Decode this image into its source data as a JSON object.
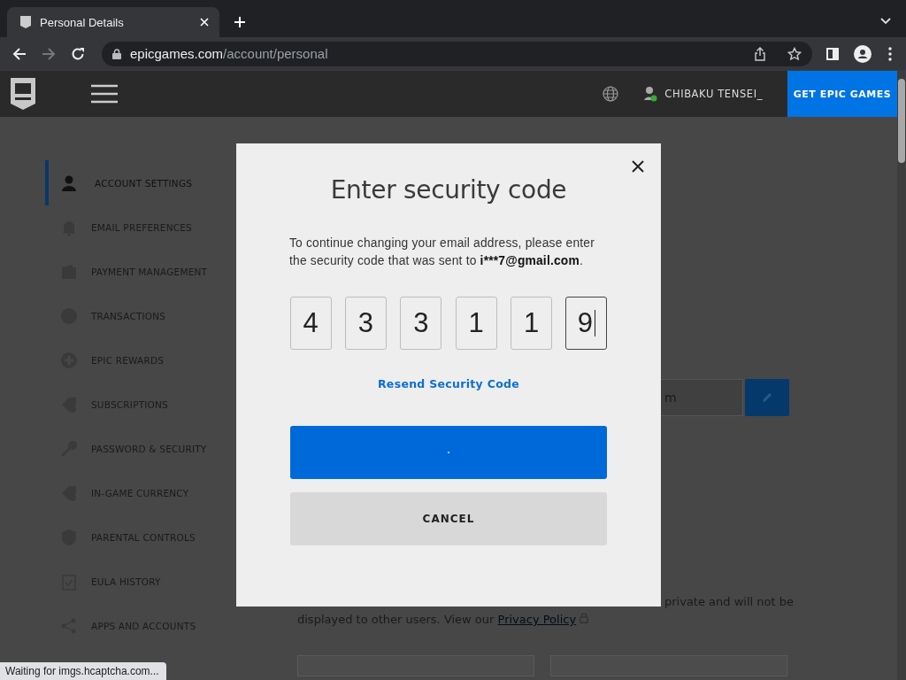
{
  "browser": {
    "tab": {
      "title": "Personal Details"
    },
    "url": {
      "host": "epicgames.com",
      "path": "/account/personal"
    }
  },
  "site_header": {
    "username": "CHIBAKU TENSEI_",
    "cta": "GET EPIC GAMES"
  },
  "sidebar": {
    "items": [
      {
        "label": "ACCOUNT SETTINGS",
        "selected": true
      },
      {
        "label": "EMAIL PREFERENCES",
        "selected": false
      },
      {
        "label": "PAYMENT MANAGEMENT",
        "selected": false
      },
      {
        "label": "TRANSACTIONS",
        "selected": false
      },
      {
        "label": "EPIC REWARDS",
        "selected": false
      },
      {
        "label": "SUBSCRIPTIONS",
        "selected": false
      },
      {
        "label": "PASSWORD & SECURITY",
        "selected": false
      },
      {
        "label": "IN-GAME CURRENCY",
        "selected": false
      },
      {
        "label": "PARENTAL CONTROLS",
        "selected": false
      },
      {
        "label": "EULA HISTORY",
        "selected": false
      },
      {
        "label": "APPS AND ACCOUNTS",
        "selected": false
      }
    ]
  },
  "content": {
    "email_field": {
      "value": "m"
    },
    "privacy": {
      "line_1": "private and will not be",
      "line_2": "displayed to other users. View our ",
      "link": "Privacy Policy"
    }
  },
  "modal": {
    "title": "Enter security code",
    "message": {
      "text": "To continue changing your email address, please enter the security code that was sent to ",
      "email": "i***7@gmail.com",
      "end": "."
    },
    "code": [
      {
        "digit": "4",
        "focused": false
      },
      {
        "digit": "3",
        "focused": false
      },
      {
        "digit": "3",
        "focused": false
      },
      {
        "digit": "1",
        "focused": false
      },
      {
        "digit": "1",
        "focused": false
      },
      {
        "digit": "9",
        "focused": true
      }
    ],
    "resend": "Resend Security Code",
    "submit": {
      "loading": true
    },
    "cancel": "CANCEL"
  },
  "status_bar": {
    "text": "Waiting for imgs.hcaptcha.com..."
  }
}
